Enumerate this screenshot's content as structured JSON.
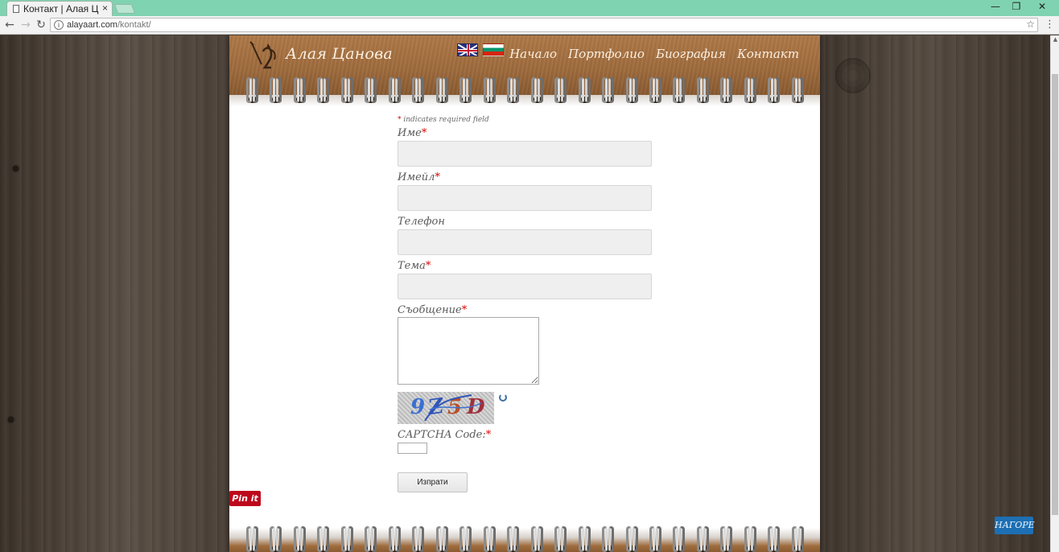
{
  "browser": {
    "tab_title": "Контакт | Алая Цан",
    "tab_close": "×",
    "url_domain": "alayaart.com",
    "url_path": "/kontakt/",
    "window_controls": [
      "—",
      "❐",
      "✕"
    ]
  },
  "site": {
    "title": "Алая Цанова",
    "nav": [
      "Начало",
      "Портфолио",
      "Биография",
      "Контакт"
    ]
  },
  "form": {
    "required_note": "indicates required field",
    "required_star": "*",
    "fields": [
      {
        "label": "Име",
        "required": true
      },
      {
        "label": "Имейл",
        "required": true
      },
      {
        "label": "Телефон",
        "required": false
      },
      {
        "label": "Тема",
        "required": true
      },
      {
        "label": "Съобщение",
        "required": true
      }
    ],
    "captcha_chars": [
      "9",
      "Z",
      "5",
      "D"
    ],
    "captcha_label": "CAPTCHA Code:",
    "submit_label": "Изпрати"
  },
  "pinit_label": "Pin it",
  "back_to_top_label": "НАГОРЕ",
  "colors": {
    "browser_frame": "#7fd3b0",
    "header_leather": "#9d6a3c",
    "pinit_red": "#bd081c",
    "back_top_blue": "#1d6fb3",
    "required_red": "#dd0000"
  }
}
